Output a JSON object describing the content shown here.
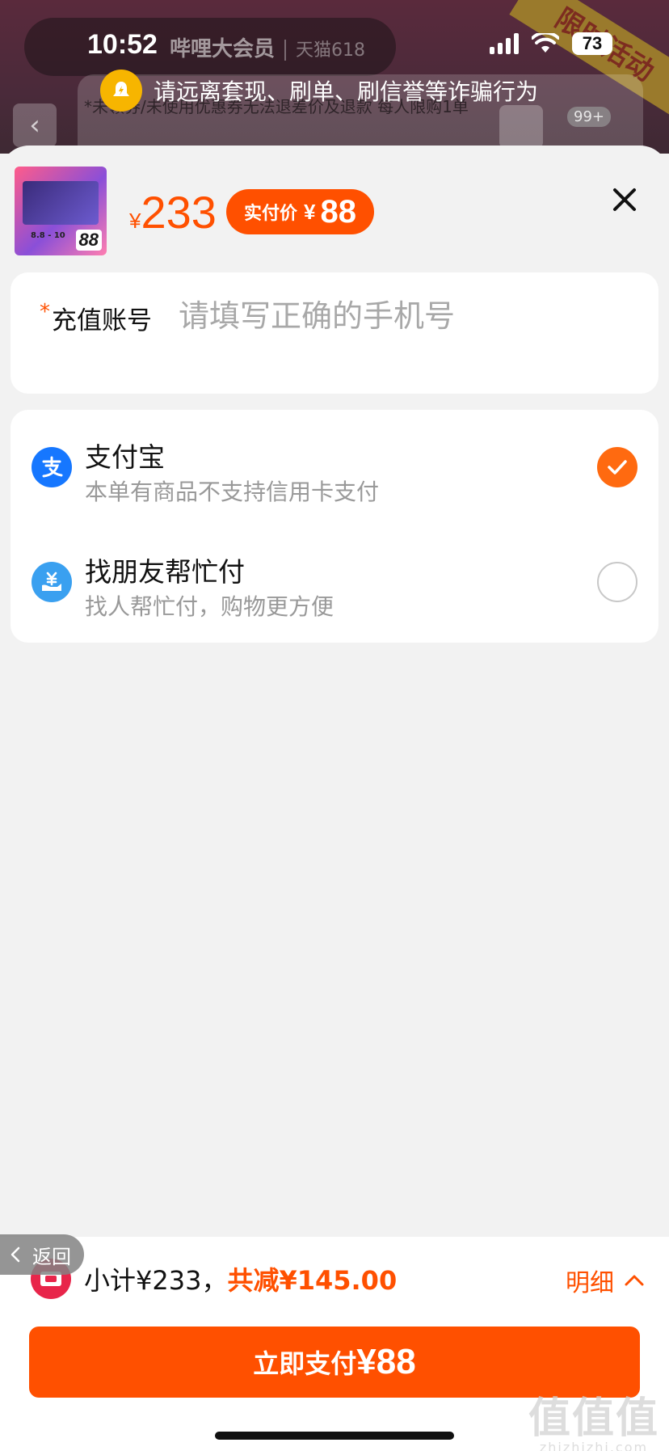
{
  "background": {
    "brand": "哔哩大会员",
    "brand_partner": "天猫618",
    "corner_banner": "限时活动",
    "notice": "*未领券/未使用优惠券无法退差价及退款  每人限购1单",
    "cart_badge": "99+"
  },
  "status_bar": {
    "time": "10:52",
    "battery": "73"
  },
  "toast": {
    "text": "请远离套现、刷单、刷信誉等诈骗行为"
  },
  "product": {
    "thumb_date": "8.8 - 10",
    "thumb_price": "88",
    "currency": "¥",
    "price": "233",
    "pay_label": "实付价",
    "pay_currency": "¥",
    "pay_price": "88"
  },
  "account": {
    "required_mark": "*",
    "label": "充值账号",
    "placeholder": "请填写正确的手机号",
    "value": ""
  },
  "payment_methods": [
    {
      "title": "支付宝",
      "subtitle": "本单有商品不支持信用卡支付",
      "selected": true,
      "icon": "alipay-icon"
    },
    {
      "title": "找朋友帮忙付",
      "subtitle": "找人帮忙付，购物更方便",
      "selected": false,
      "icon": "friend-pay-icon"
    }
  ],
  "bottom": {
    "subtotal": "小计¥233，",
    "discount": "共减¥145.00",
    "detail_label": "明细",
    "back_label": "返回",
    "pay_button_label": "立即支付",
    "pay_button_amount": "¥88"
  },
  "watermark": {
    "main": "值值值",
    "sub": "zhizhizhi.com"
  },
  "colors": {
    "accent": "#ff5000",
    "checked": "#ff6a10",
    "alipay": "#1677ff",
    "friend_pay": "#3aa0f0",
    "toast_icon": "#f7b500",
    "coupon_icon": "#e8254a"
  }
}
